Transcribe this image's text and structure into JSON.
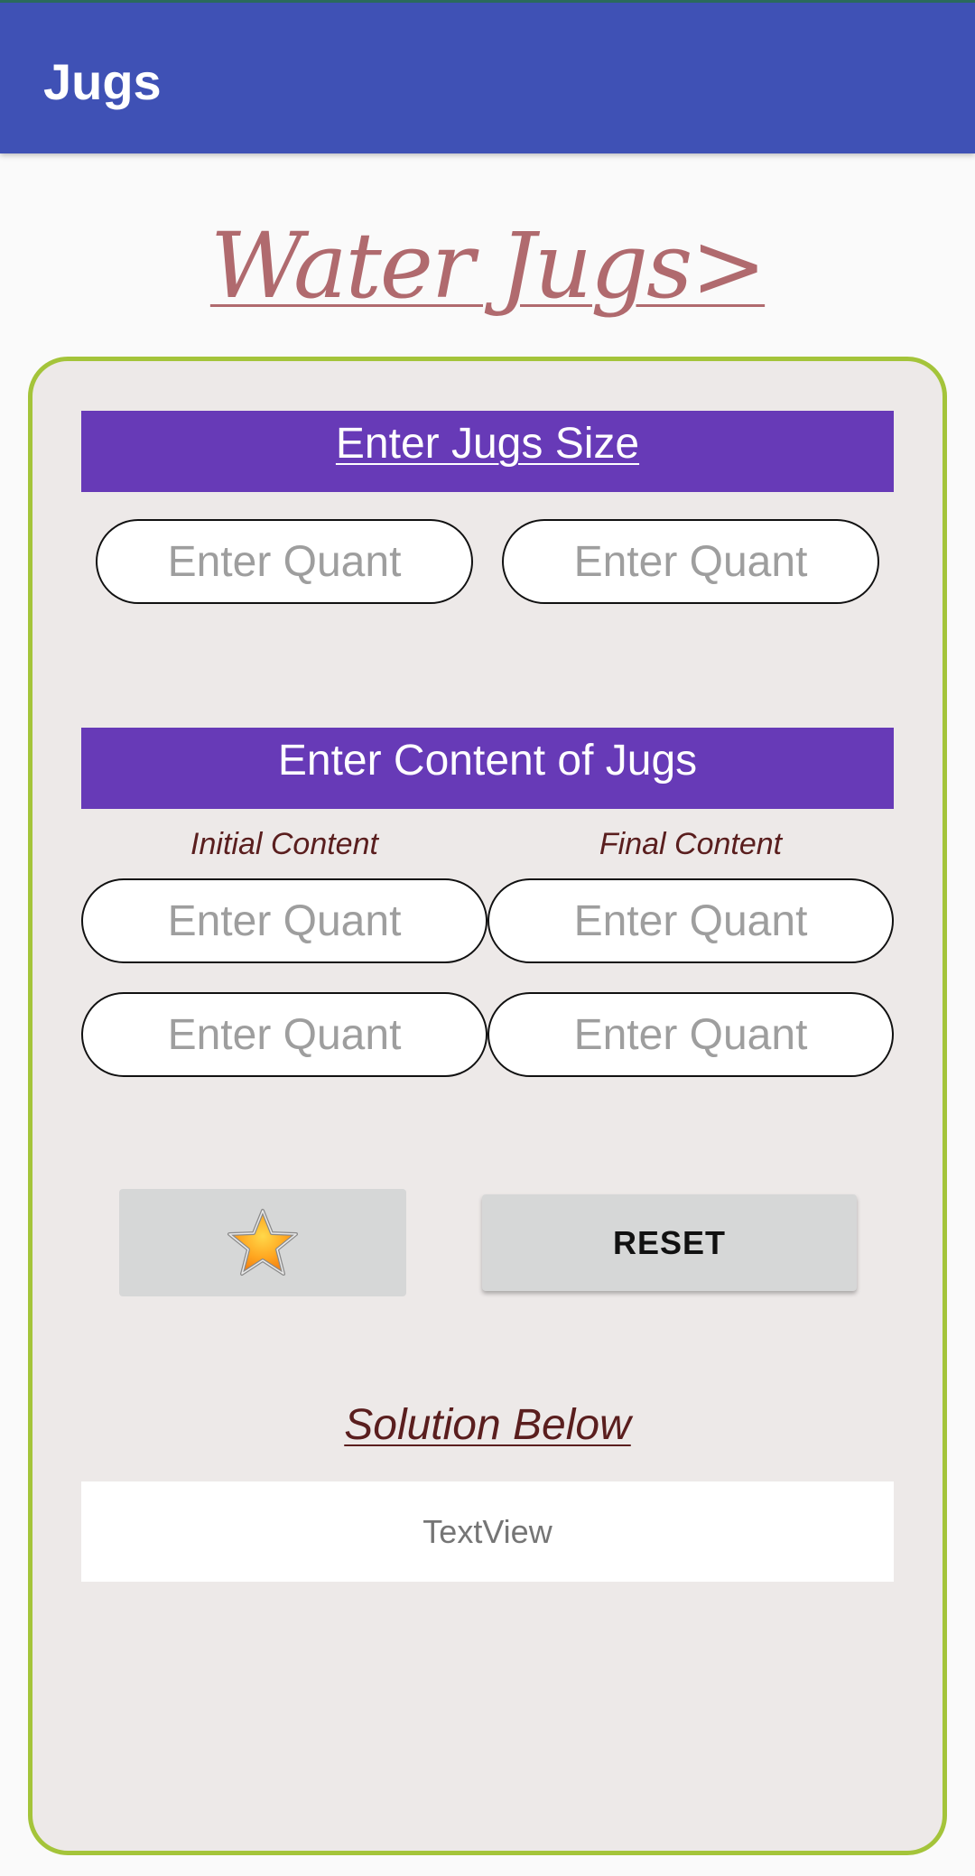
{
  "app_bar": {
    "title": "Jugs"
  },
  "page_title": "Water Jugs>",
  "jug_size_section": {
    "header": "Enter Jugs Size",
    "inputs": [
      {
        "placeholder": "Enter Quant",
        "value": ""
      },
      {
        "placeholder": "Enter Quant",
        "value": ""
      }
    ]
  },
  "content_section": {
    "header": "Enter Content of Jugs",
    "initial_label": "Initial Content",
    "final_label": "Final Content",
    "inputs": [
      {
        "placeholder": "Enter Quant",
        "value": ""
      },
      {
        "placeholder": "Enter Quant",
        "value": ""
      },
      {
        "placeholder": "Enter Quant",
        "value": ""
      },
      {
        "placeholder": "Enter Quant",
        "value": ""
      }
    ]
  },
  "actions": {
    "star_icon": "star-icon",
    "reset_label": "RESET"
  },
  "solution": {
    "label": "Solution Below",
    "text": "TextView"
  },
  "colors": {
    "app_bar": "#3f51b5",
    "section_header": "#673ab7",
    "panel_border": "#a4c43a",
    "panel_bg": "#ede9e8",
    "title_text": "#b06a6e",
    "label_text": "#5a1e1e"
  }
}
